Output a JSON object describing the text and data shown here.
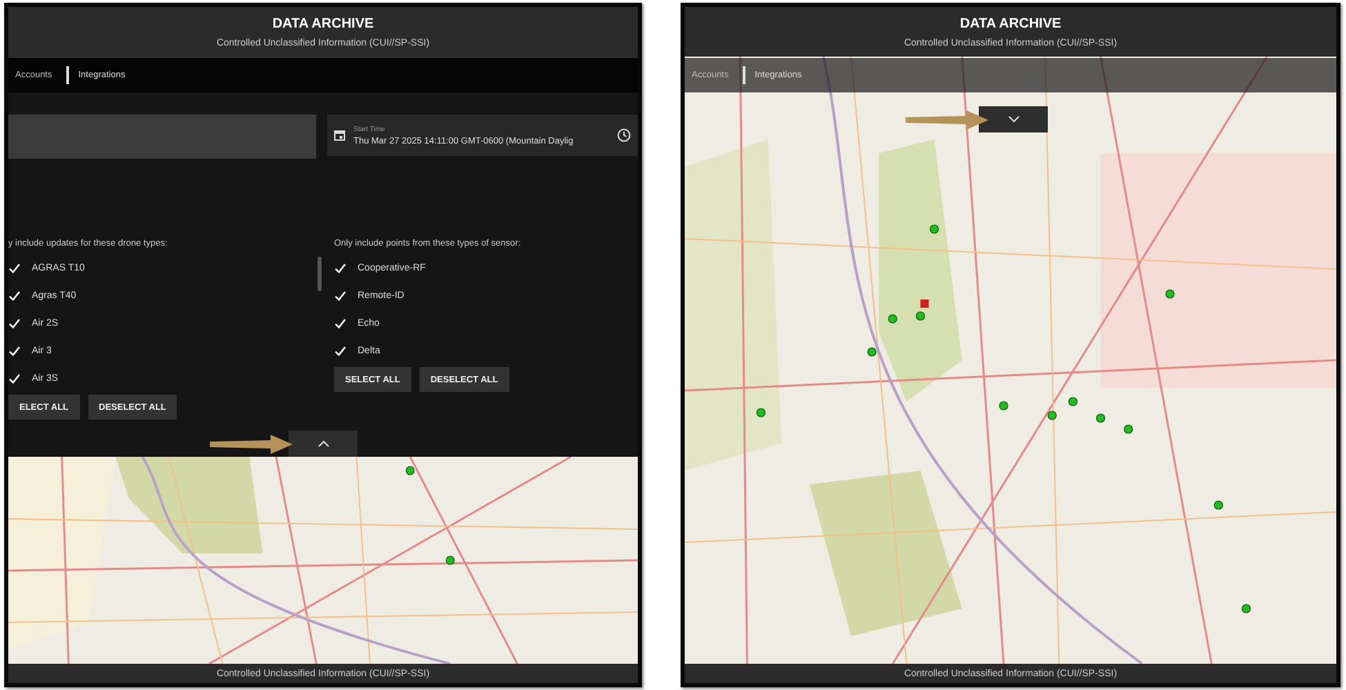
{
  "panels": [
    {
      "expanded": true,
      "header": {
        "title": "DATA ARCHIVE",
        "subtitle": "Controlled Unclassified Information (CUI//SP-SSI)"
      },
      "tabs": [
        {
          "label": "Accounts",
          "selected": false
        },
        {
          "label": "Integrations",
          "selected": true
        }
      ],
      "start_time": {
        "label": "Start Time",
        "value": "Thu Mar 27 2025 14:11:00 GMT-0600 (Mountain Daylig"
      },
      "filters": [
        {
          "heading": "y include updates for these drone types:",
          "items": [
            {
              "label": "AGRAS T10",
              "checked": true
            },
            {
              "label": "Agras T40",
              "checked": true
            },
            {
              "label": "Air 2S",
              "checked": true
            },
            {
              "label": "Air 3",
              "checked": true
            },
            {
              "label": "Air 3S",
              "checked": true
            }
          ],
          "buttons": [
            "ELECT ALL",
            "DESELECT ALL"
          ]
        },
        {
          "heading": "Only include points from these types of sensor:",
          "items": [
            {
              "label": "Cooperative-RF",
              "checked": true
            },
            {
              "label": "Remote-ID",
              "checked": true
            },
            {
              "label": "Echo",
              "checked": true
            },
            {
              "label": "Delta",
              "checked": true
            }
          ],
          "buttons": [
            "SELECT ALL",
            "DESELECT ALL"
          ]
        }
      ],
      "footer": "Controlled Unclassified Information (CUI//SP-SSI)"
    },
    {
      "expanded": false,
      "header": {
        "title": "DATA ARCHIVE",
        "subtitle": "Controlled Unclassified Information (CUI//SP-SSI)"
      },
      "tabs": [
        {
          "label": "Accounts",
          "selected": false
        },
        {
          "label": "Integrations",
          "selected": true
        }
      ],
      "footer": "Controlled Unclassified Information (CUI//SP-SSI)"
    }
  ]
}
